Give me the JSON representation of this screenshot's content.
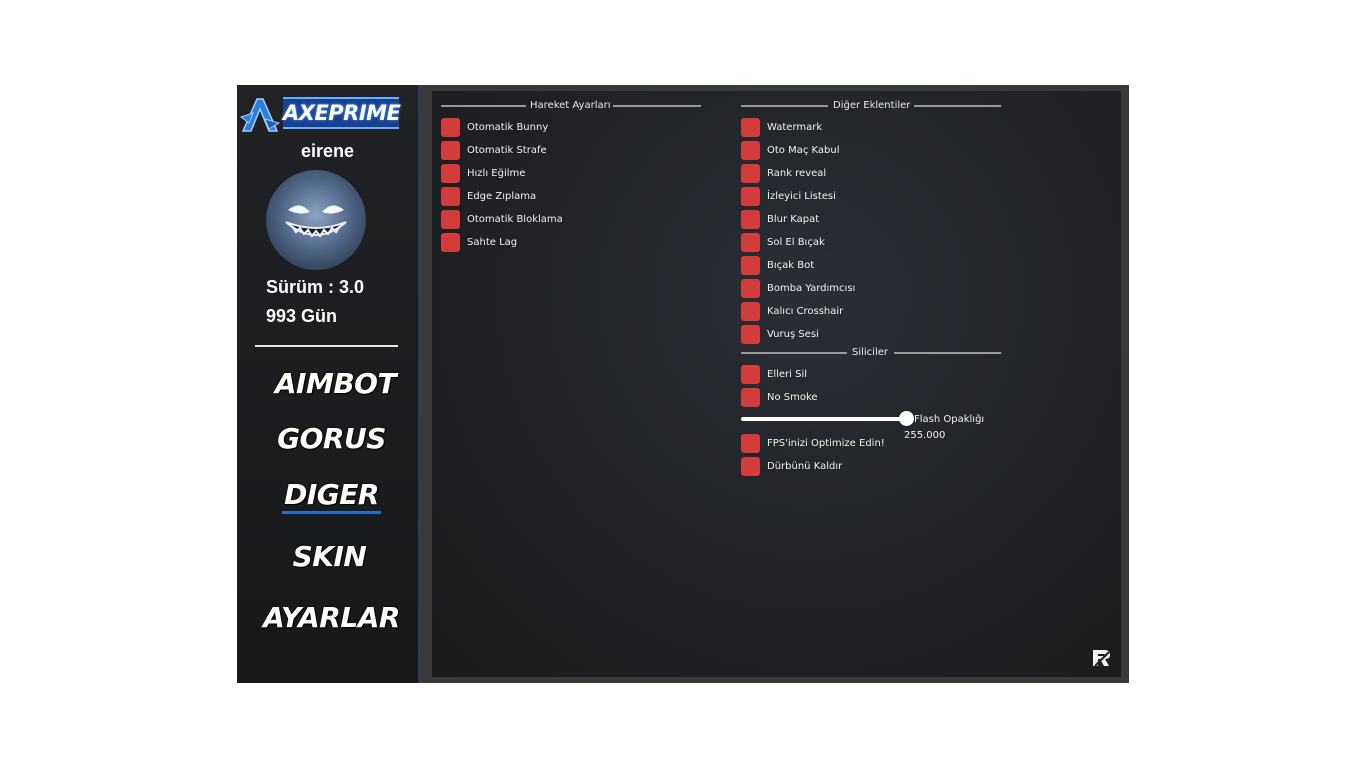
{
  "brand": {
    "name": "AXEPRIME"
  },
  "user": {
    "name": "eirene",
    "version": "Sürüm : 3.0",
    "days": "993 Gün"
  },
  "nav": {
    "aimbot": "AIMBOT",
    "gorus": "GORUS",
    "diger": "DIGER",
    "skin": "SKIN",
    "ayarlar": "AYARLAR",
    "active": "DIGER"
  },
  "movement": {
    "title": "Hareket Ayarları",
    "items": [
      "Otomatik Bunny",
      "Otomatik Strafe",
      "Hızlı Eğilme",
      "Edge Zıplama",
      "Otomatik Bloklama",
      "Sahte Lag"
    ]
  },
  "extras": {
    "title": "Diğer Eklentiler",
    "items": [
      "Watermark",
      "Oto Maç Kabul",
      "Rank reveal",
      "İzleyici Listesi",
      "Blur Kapat",
      "Sol El Bıçak",
      "Bıçak Bot",
      "Bomba Yardımcısı",
      "Kalıcı Crosshair",
      "Vuruş Sesi"
    ]
  },
  "removals": {
    "title": "Siliciler",
    "items": [
      "Elleri Sil",
      "No Smoke"
    ],
    "slider": {
      "label": "Flash Opaklığı",
      "value": "255.000",
      "fraction": 1.0
    },
    "items_after": [
      "FPS'inizi Optimize Edin!",
      "Dürbünü Kaldır"
    ]
  },
  "colors": {
    "checkbox": "#d23c3c",
    "accent": "#1e6fd0",
    "panel": "#1f2124"
  },
  "icons": {
    "logo": "axe-logo-icon",
    "corner": "watermark-logo-icon"
  }
}
